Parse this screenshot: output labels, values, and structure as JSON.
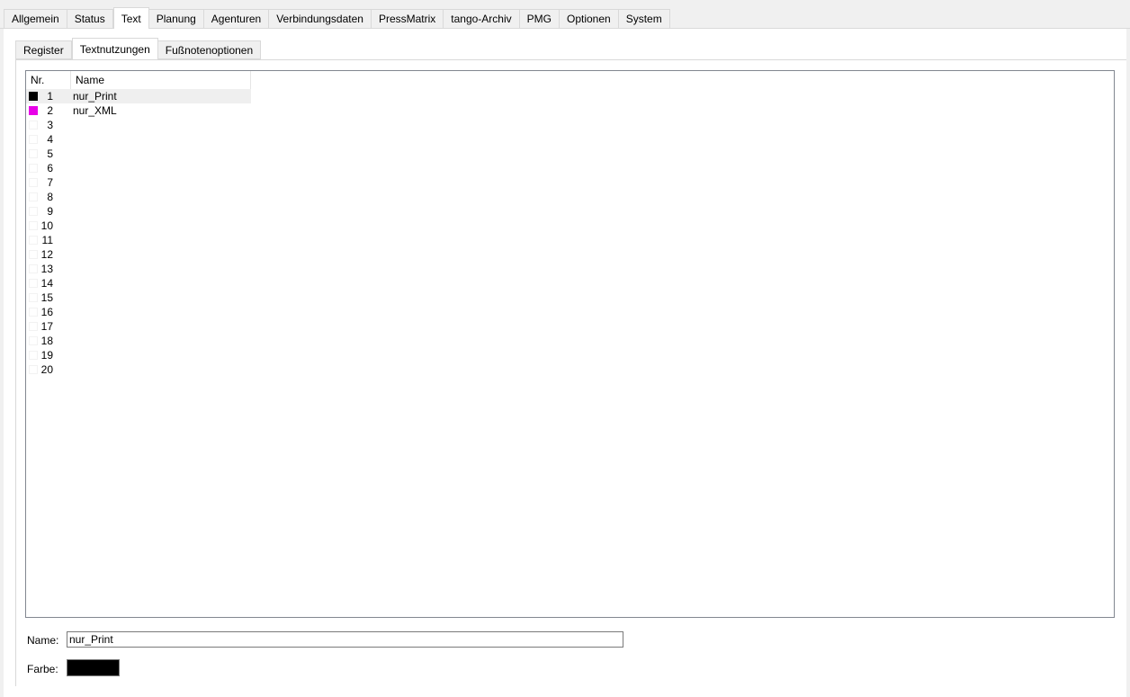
{
  "top_tabs": [
    {
      "label": "Allgemein"
    },
    {
      "label": "Status"
    },
    {
      "label": "Text",
      "active": true
    },
    {
      "label": "Planung"
    },
    {
      "label": "Agenturen"
    },
    {
      "label": "Verbindungsdaten"
    },
    {
      "label": "PressMatrix"
    },
    {
      "label": "tango-Archiv"
    },
    {
      "label": "PMG"
    },
    {
      "label": "Optionen"
    },
    {
      "label": "System"
    }
  ],
  "sub_tabs": [
    {
      "label": "Register"
    },
    {
      "label": "Textnutzungen",
      "active": true
    },
    {
      "label": "Fußnotenoptionen"
    }
  ],
  "list": {
    "columns": {
      "nr": "Nr.",
      "name": "Name"
    },
    "rows": [
      {
        "nr": "1",
        "name": "nur_Print",
        "color": "#000000",
        "selected": true
      },
      {
        "nr": "2",
        "name": "nur_XML",
        "color": "#e800e8"
      },
      {
        "nr": "3",
        "name": ""
      },
      {
        "nr": "4",
        "name": ""
      },
      {
        "nr": "5",
        "name": ""
      },
      {
        "nr": "6",
        "name": ""
      },
      {
        "nr": "7",
        "name": ""
      },
      {
        "nr": "8",
        "name": ""
      },
      {
        "nr": "9",
        "name": ""
      },
      {
        "nr": "10",
        "name": ""
      },
      {
        "nr": "11",
        "name": ""
      },
      {
        "nr": "12",
        "name": ""
      },
      {
        "nr": "13",
        "name": ""
      },
      {
        "nr": "14",
        "name": ""
      },
      {
        "nr": "15",
        "name": ""
      },
      {
        "nr": "16",
        "name": ""
      },
      {
        "nr": "17",
        "name": ""
      },
      {
        "nr": "18",
        "name": ""
      },
      {
        "nr": "19",
        "name": ""
      },
      {
        "nr": "20",
        "name": ""
      }
    ]
  },
  "form": {
    "name_label": "Name:",
    "name_value": "nur_Print",
    "color_label": "Farbe:",
    "color_value": "#000000"
  }
}
